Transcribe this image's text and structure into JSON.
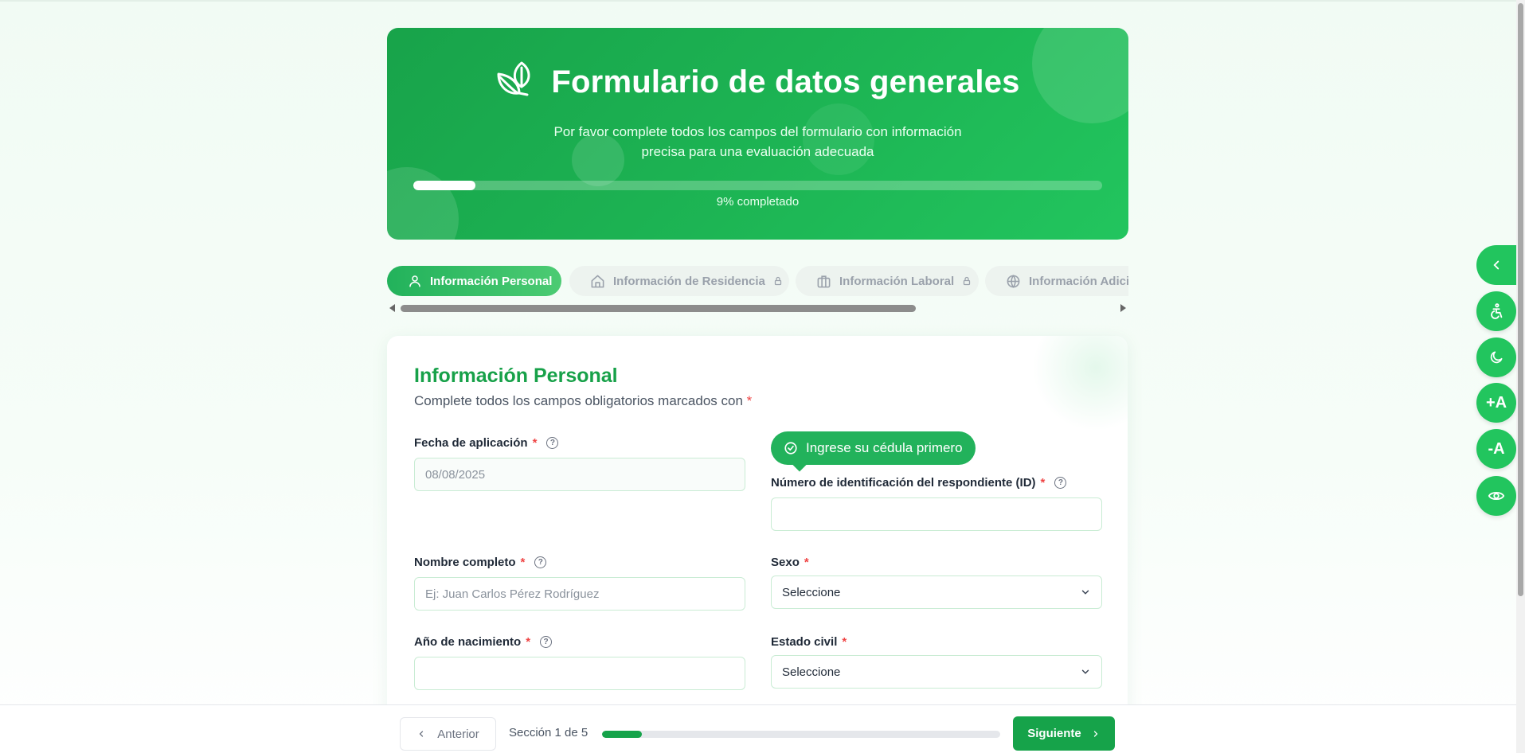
{
  "header": {
    "title": "Formulario de datos generales",
    "subtitle_line1": "Por favor complete todos los campos del formulario con información",
    "subtitle_line2": "precisa para una evaluación adecuada",
    "progress_percent": 9,
    "progress_label": "9% completado",
    "icon": "leaf-icon"
  },
  "tabs": [
    {
      "label": "Información Personal",
      "icon": "user-icon",
      "active": true,
      "locked": false
    },
    {
      "label": "Información de Residencia",
      "icon": "home-icon",
      "active": false,
      "locked": true
    },
    {
      "label": "Información Laboral",
      "icon": "briefcase-icon",
      "active": false,
      "locked": true
    },
    {
      "label": "Información Adicional",
      "icon": "globe-icon",
      "active": false,
      "locked": false
    }
  ],
  "form": {
    "title": "Información Personal",
    "subtitle": "Complete todos los campos obligatorios marcados con",
    "required_mark": "*",
    "hint_pill": "Ingrese su cédula primero",
    "fields": {
      "fecha": {
        "label": "Fecha de aplicación",
        "value": "08/08/2025"
      },
      "id": {
        "label": "Número de identificación del respondiente (ID)",
        "value": ""
      },
      "nombre": {
        "label": "Nombre completo",
        "placeholder": "Ej: Juan Carlos Pérez Rodríguez",
        "value": ""
      },
      "sexo": {
        "label": "Sexo",
        "selected": "Seleccione"
      },
      "anio": {
        "label": "Año de nacimiento",
        "value": ""
      },
      "estado_civil": {
        "label": "Estado civil",
        "selected": "Seleccione"
      }
    }
  },
  "footer": {
    "prev_label": "Anterior",
    "next_label": "Siguiente",
    "section_label": "Sección 1 de 5",
    "section_progress_fraction": 0.1
  },
  "tools": {
    "toggle_icon": "chevron-left-icon",
    "accessibility_icon": "accessibility-icon",
    "dark_mode_icon": "moon-icon",
    "font_increase_label": "+A",
    "font_decrease_label": "-A",
    "visibility_icon": "eye-icon"
  },
  "colors": {
    "brand": "#16a34a",
    "accent": "#22c55e",
    "required": "#ef4444"
  }
}
